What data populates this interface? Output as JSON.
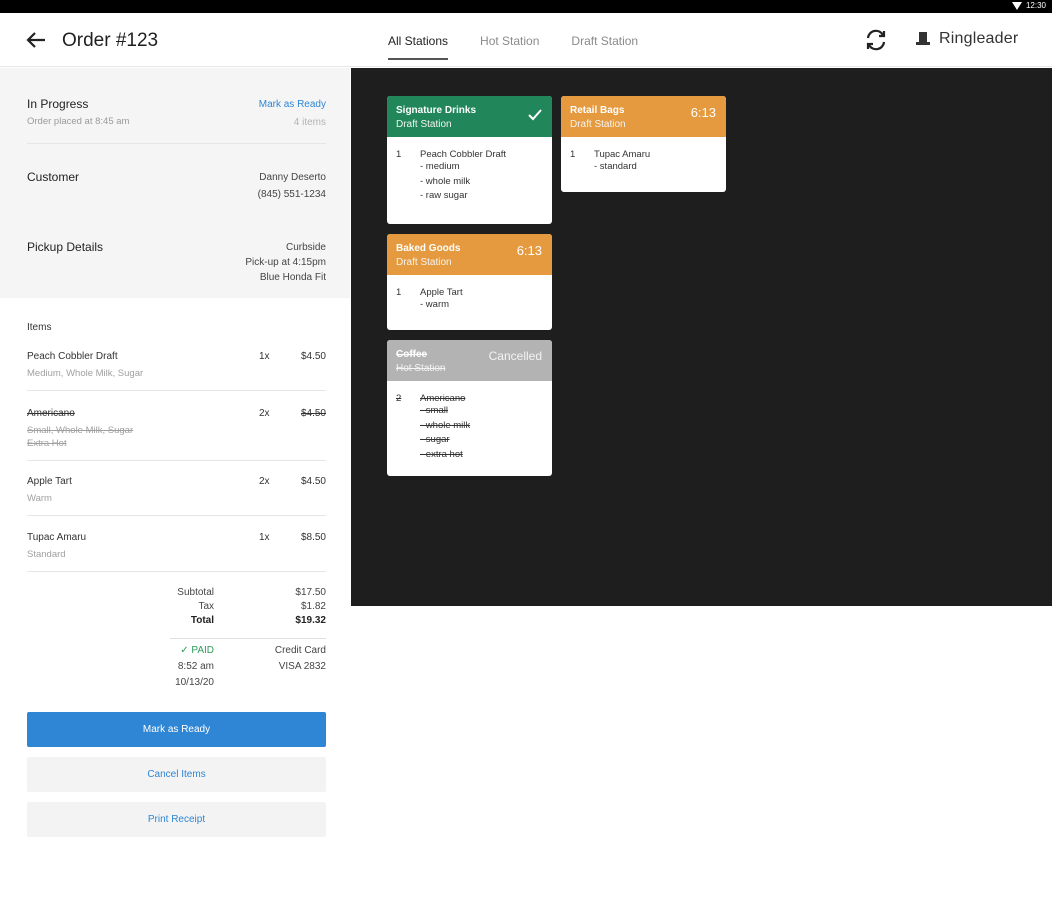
{
  "status_bar": {
    "time": "12:30"
  },
  "topbar": {
    "order_title": "Order #123",
    "tabs": [
      {
        "label": "All Stations",
        "active": true
      },
      {
        "label": "Hot Station",
        "active": false
      },
      {
        "label": "Draft Station",
        "active": false
      }
    ],
    "brand_name": "Ringleader"
  },
  "order": {
    "status_title": "In Progress",
    "status_sub": "Order placed at 8:45 am",
    "mark_ready_link": "Mark as Ready",
    "item_count": "4 items",
    "customer_label": "Customer",
    "customer_name": "Danny Deserto",
    "customer_phone": "(845) 551-1234",
    "pickup_label": "Pickup Details",
    "pickup_method": "Curbside",
    "pickup_time": "Pick-up at 4:15pm",
    "pickup_vehicle": "Blue Honda Fit",
    "items_label": "Items",
    "items": [
      {
        "name": "Peach Cobbler Draft",
        "mods": "Medium, Whole Milk, Sugar",
        "qty": "1x",
        "price": "$4.50"
      },
      {
        "name": "Americano",
        "mods": "Small, Whole Milk, Sugar",
        "mods2": "Extra Hot",
        "qty": "2x",
        "price": "$4.50",
        "cancelled": true
      },
      {
        "name": "Apple Tart",
        "mods": "Warm",
        "qty": "2x",
        "price": "$4.50"
      },
      {
        "name": "Tupac Amaru",
        "mods": "Standard",
        "qty": "1x",
        "price": "$8.50"
      }
    ],
    "totals": {
      "subtotal_label": "Subtotal",
      "subtotal": "$17.50",
      "tax_label": "Tax",
      "tax": "$1.82",
      "total_label": "Total",
      "total": "$19.32"
    },
    "payment": {
      "status": "PAID",
      "time": "8:52 am",
      "date": "10/13/20",
      "method": "Credit Card",
      "card": "VISA 2832"
    },
    "buttons": {
      "mark_ready": "Mark as Ready",
      "cancel_items": "Cancel Items",
      "print_receipt": "Print Receipt"
    }
  },
  "tickets": [
    {
      "title": "Signature Drinks",
      "station": "Draft Station",
      "color": "#21875a",
      "done": true,
      "qty": "1",
      "item": "Peach Cobbler Draft",
      "mods": [
        "- medium",
        "- whole milk",
        "- raw sugar"
      ]
    },
    {
      "title": "Retail Bags",
      "station": "Draft Station",
      "color": "#e69a3f",
      "timer": "6:13",
      "qty": "1",
      "item": "Tupac Amaru",
      "mods": [
        "- standard"
      ]
    },
    {
      "title": "Baked Goods",
      "station": "Draft Station",
      "color": "#e69a3f",
      "timer": "6:13",
      "qty": "1",
      "item": "Apple Tart",
      "mods": [
        "- warm"
      ]
    },
    {
      "title": "Coffee",
      "station": "Hot Station",
      "color": "#b3b3b3",
      "status": "Cancelled",
      "qty": "2",
      "item": "Americano",
      "mods": [
        "- small",
        "- whole milk",
        "- sugar",
        "- extra hot"
      ]
    }
  ],
  "colors": {
    "accent": "#2f86d4",
    "board": "#1e1e1e",
    "paid": "#2d9a5b"
  }
}
